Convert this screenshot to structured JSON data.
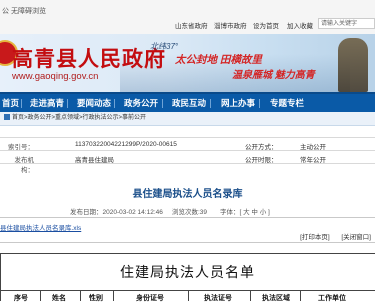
{
  "topbar": {
    "line1": "公 无障碍浏览",
    "links": [
      "山东省政府",
      "淄博市政府",
      "设为首页",
      "加入收藏"
    ],
    "search_placeholder": "请输入关键字",
    "line2_prefix": "高青县人民政府"
  },
  "header": {
    "site_title": "高青县人民政府",
    "site_url": "www.gaoqing.gov.cn",
    "latitude_tag": "北纬37°",
    "slogan_1": "太公封地 田横故里",
    "slogan_2": "温泉雁城 魅力高青"
  },
  "nav": {
    "items": [
      "首页",
      "走进高青",
      "要闻动态",
      "政务公开",
      "政民互动",
      "网上办事",
      "专题专栏"
    ]
  },
  "breadcrumb": "首页>政务公开>重点领域>行政执法公示>事前公开",
  "info": {
    "row1": {
      "k": "索引号：",
      "v": "11370322004221299P/2020-00615",
      "k2": "公开方式：",
      "v2": "主动公开"
    },
    "row2": {
      "k": "发布机构：",
      "v": "高青县住建局",
      "k2": "公开时限：",
      "v2": "常年公开"
    }
  },
  "article": {
    "title": "县住建局执法人员名录库",
    "publish": "发布日期：2020-03-02 14:12:46",
    "views": "浏览次数:39",
    "font_size": "字体：[ 大 中 小 ]",
    "attachment": "县住建局执法人员名录库.xls",
    "print": "[打印本页]",
    "close": "[关闭窗口]"
  },
  "document": {
    "title": "住建局执法人员名单",
    "headers": [
      "序号",
      "姓名",
      "性别",
      "身份证号",
      "执法证号",
      "执法区域",
      "工作单位"
    ]
  }
}
